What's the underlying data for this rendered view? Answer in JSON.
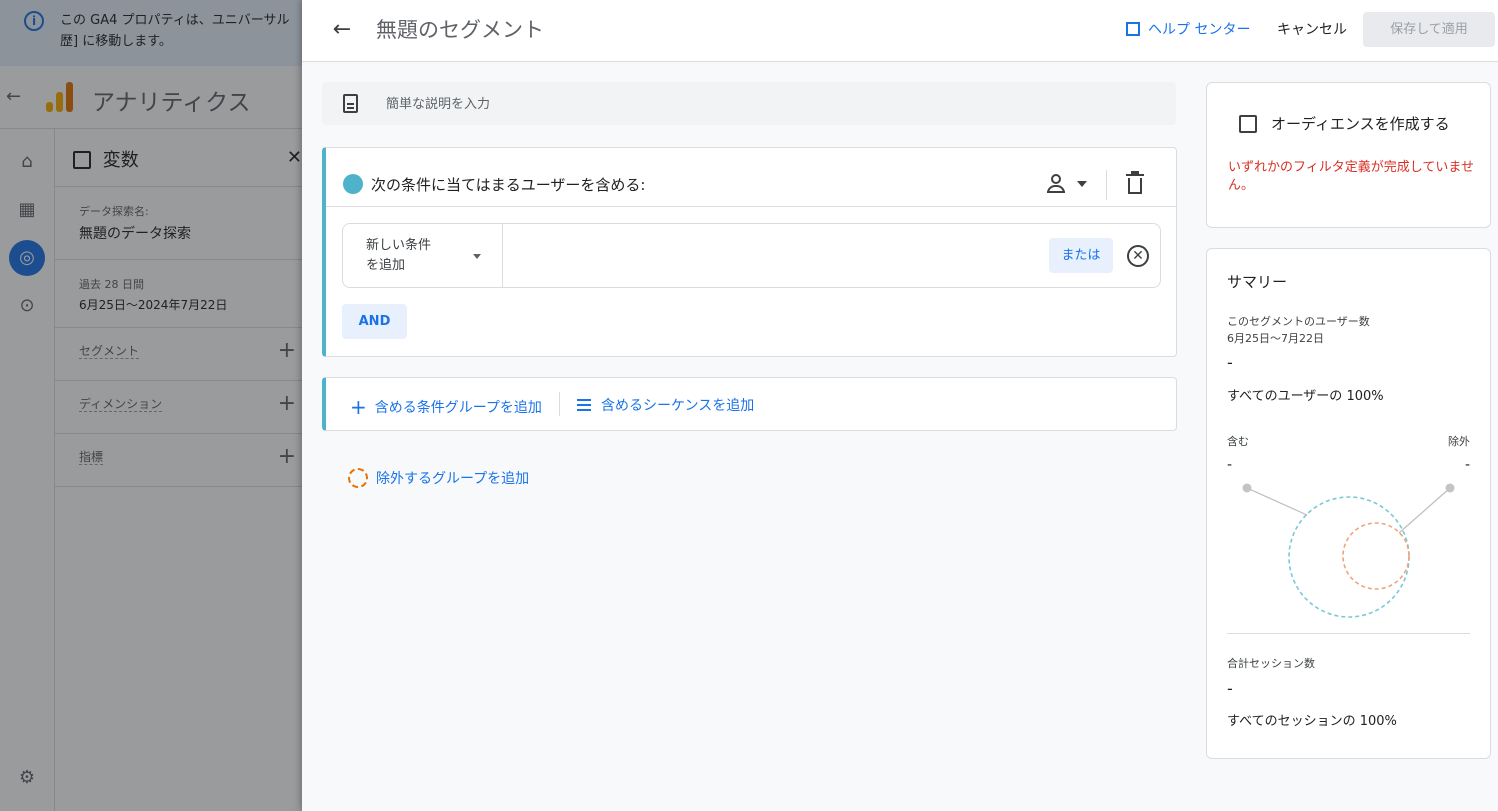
{
  "background": {
    "banner": {
      "line1": "この GA4 プロパティは、ユニバーサル",
      "line2": "歴] に移動します。"
    },
    "app_title": "アナリティクス",
    "variables_panel": {
      "title": "変数",
      "exploration_name_label": "データ探索名:",
      "exploration_name": "無題のデータ探索",
      "date_range_label": "過去 28 日間",
      "date_range": "6月25日～2024年7月22日",
      "segments_label": "セグメント",
      "dimensions_label": "ディメンション",
      "metrics_label": "指標"
    }
  },
  "editor": {
    "title": "無題のセグメント",
    "help_label": "ヘルプ センター",
    "cancel_label": "キャンセル",
    "save_label": "保存して適用",
    "description_placeholder": "簡単な説明を入力",
    "condition_group": {
      "title": "次の条件に当てはまるユーザーを含める:",
      "accent_color": "#4fb2cb",
      "add_condition_line1": "新しい条件",
      "add_condition_line2": "を追加",
      "or_label": "または",
      "and_label": "AND"
    },
    "add_include_group_label": "含める条件グループを追加",
    "add_sequence_label": "含めるシーケンスを追加",
    "add_exclude_group_label": "除外するグループを追加"
  },
  "audience": {
    "label": "オーディエンスを作成する",
    "warning": "いずれかのフィルタ定義が完成していません。"
  },
  "summary": {
    "title": "サマリー",
    "users_label": "このセグメントのユーザー数",
    "users_range": "6月25日～7月22日",
    "users_value": "-",
    "users_pct": "すべてのユーザーの 100%",
    "include_label": "含む",
    "exclude_label": "除外",
    "include_value": "-",
    "exclude_value": "-",
    "sessions_label": "合計セッション数",
    "sessions_value": "-",
    "sessions_pct": "すべてのセッションの 100%",
    "include_color": "#78c9d6",
    "exclude_color": "#f0a37c"
  }
}
